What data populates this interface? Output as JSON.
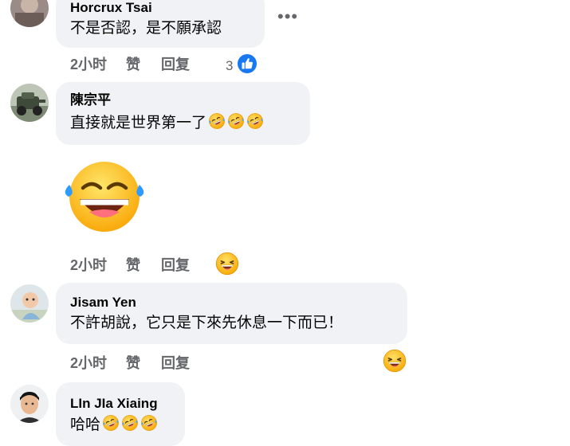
{
  "comments": [
    {
      "author": "Horcrux Tsai",
      "text": "不是否認，是不願承認",
      "time": "2小时",
      "like": "赞",
      "reply": "回复",
      "reaction_count": "3"
    },
    {
      "author": "陳宗平",
      "text": "直接就是世界第一了",
      "time": "2小时",
      "like": "赞",
      "reply": "回复"
    },
    {
      "author": "Jisam Yen",
      "text": "不許胡說，它只是下來先休息一下而已！",
      "time": "2小时",
      "like": "赞",
      "reply": "回复"
    },
    {
      "author": "LIn JIa Xiaing",
      "text": "哈哈",
      "time": "",
      "like": "",
      "reply": ""
    }
  ],
  "icons": {
    "more": "more-options-icon",
    "like_reaction": "like-reaction-icon",
    "laugh_reaction": "laugh-reaction-icon",
    "rofl_emoji": "rolling-laughing-emoji",
    "tears_of_joy_sticker": "tears-of-joy-sticker"
  },
  "colors": {
    "bubble": "#f0f2f5",
    "secondary_text": "#65676b",
    "like_blue": "#1877f2",
    "emoji_yellow": "#ffc83d"
  }
}
